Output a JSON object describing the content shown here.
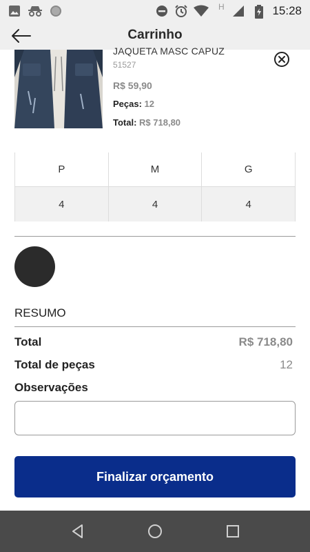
{
  "status_bar": {
    "time": "15:28",
    "icons": [
      "image-icon",
      "incognito-icon",
      "circle-icon",
      "do-not-disturb-icon",
      "alarm-icon",
      "wifi-icon",
      "h-network-icon",
      "signal-icon",
      "battery-icon"
    ],
    "network_label": "H"
  },
  "app_bar": {
    "title": "Carrinho"
  },
  "product": {
    "name": "JAQUETA MASC CAPUZ",
    "code": "51527",
    "price": "R$ 59,90",
    "pieces_label": "Peças:",
    "pieces_value": "12",
    "total_label": "Total:",
    "total_value": "R$ 718,80"
  },
  "sizes": {
    "headers": [
      "P",
      "M",
      "G"
    ],
    "quantities": [
      "4",
      "4",
      "4"
    ]
  },
  "colors": {
    "swatch": "#2b2b2b",
    "accent": "#0a2d8b"
  },
  "summary": {
    "title": "RESUMO",
    "total_label": "Total",
    "total_value": "R$ 718,80",
    "pieces_label": "Total de peças",
    "pieces_value": "12",
    "notes_label": "Observações",
    "notes_value": ""
  },
  "actions": {
    "finish_label": "Finalizar orçamento"
  }
}
